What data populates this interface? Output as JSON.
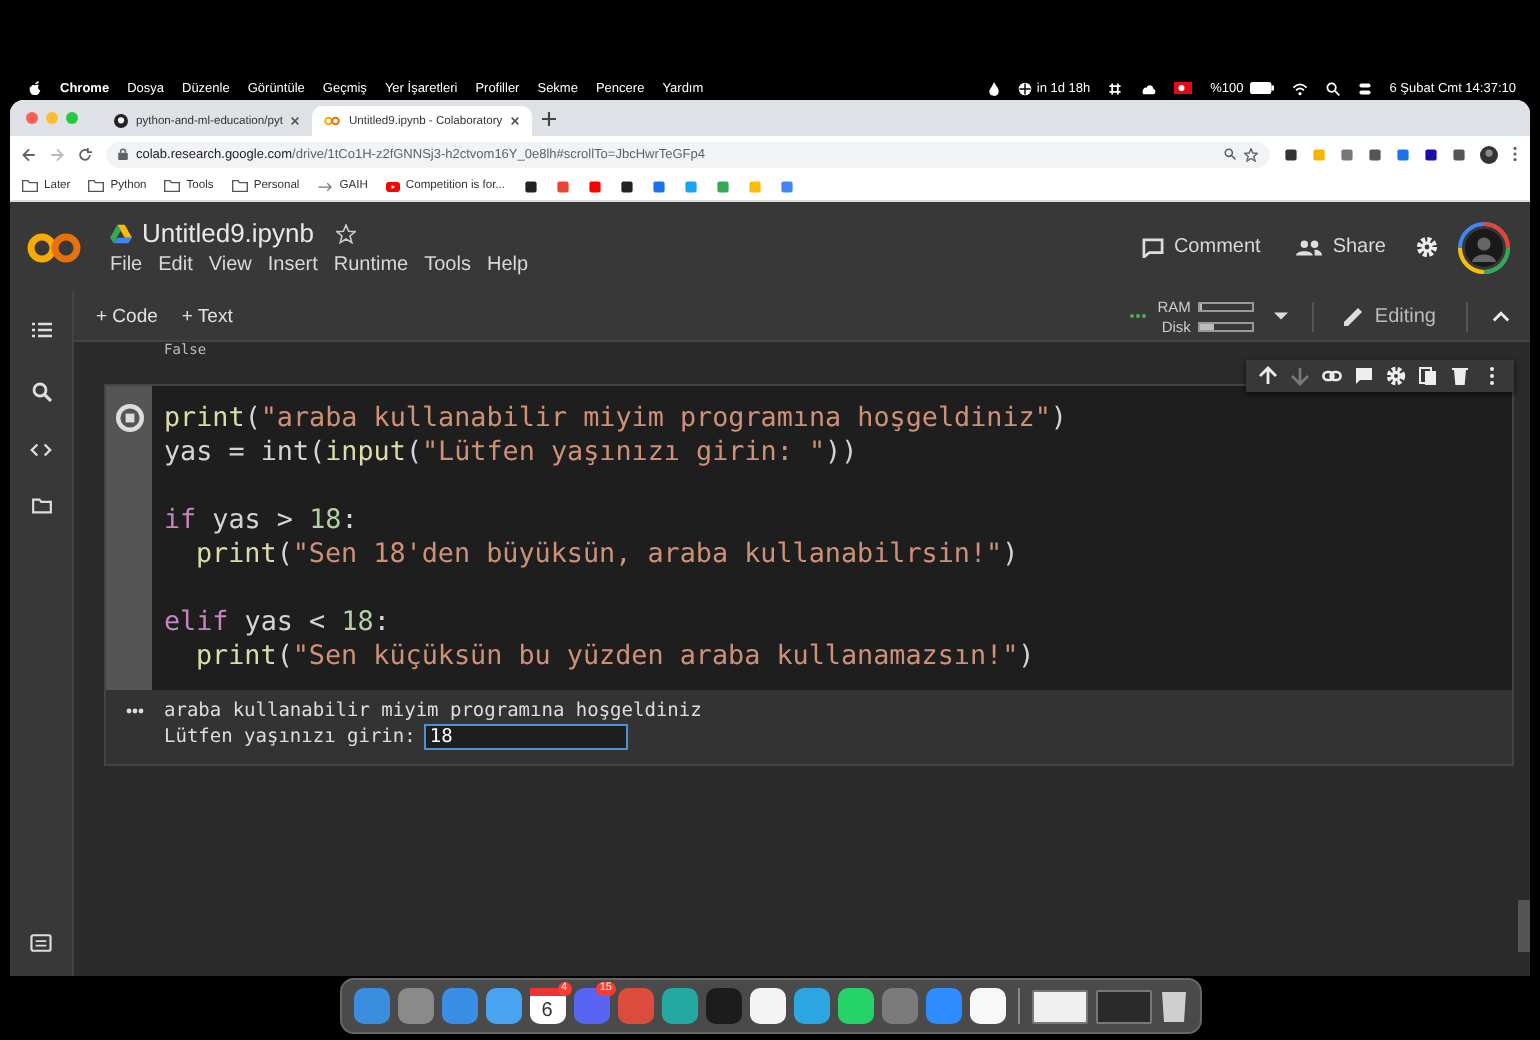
{
  "menubar": {
    "app": "Chrome",
    "menus": [
      "Dosya",
      "Düzenle",
      "Görüntüle",
      "Geçmiş",
      "Yer İşaretleri",
      "Profiller",
      "Sekme",
      "Pencere",
      "Yardım"
    ],
    "timer": "in 1d 18h",
    "battery": "%100",
    "clock": "6 Şubat Cmt  14:37:10"
  },
  "browser": {
    "tabs": [
      {
        "title": "python-and-ml-education/pyt",
        "selected": false
      },
      {
        "title": "Untitled9.ipynb - Colaboratory",
        "selected": true
      }
    ],
    "url_host": "colab.research.google.com",
    "url_path": "/drive/1tCo1H-z2fGNNSj3-h2ctvom16Y_0e8lh#scrollTo=JbcHwrTeGFp4",
    "bookmarks": [
      {
        "kind": "folder",
        "label": "Later"
      },
      {
        "kind": "folder",
        "label": "Python"
      },
      {
        "kind": "folder",
        "label": "Tools"
      },
      {
        "kind": "folder",
        "label": "Personal"
      },
      {
        "kind": "arrow",
        "label": "GAIH"
      },
      {
        "kind": "video",
        "label": "Competition is for..."
      }
    ]
  },
  "colab": {
    "title": "Untitled9.ipynb",
    "menus": [
      "File",
      "Edit",
      "View",
      "Insert",
      "Runtime",
      "Tools",
      "Help"
    ],
    "comment": "Comment",
    "share": "Share",
    "add_buttons": [
      "+ Code",
      "+ Text"
    ],
    "resources": [
      {
        "label": "RAM",
        "level": 0.03
      },
      {
        "label": "Disk",
        "level": 0.25
      }
    ],
    "mode": "Editing"
  },
  "notebook": {
    "previous_output": "False",
    "lines": [
      {
        "kind": "code",
        "indented": false,
        "tokens": [
          {
            "kind": "fn",
            "text": "print"
          },
          {
            "kind": "plain",
            "text": "("
          },
          {
            "kind": "str",
            "text": "\"araba kullanabilir miyim programına hoşgeldiniz\""
          },
          {
            "kind": "plain",
            "text": ")"
          }
        ]
      },
      {
        "kind": "code",
        "indented": false,
        "tokens": [
          {
            "kind": "plain",
            "text": "yas = int("
          },
          {
            "kind": "fn",
            "text": "input"
          },
          {
            "kind": "plain",
            "text": "("
          },
          {
            "kind": "str",
            "text": "\"Lütfen yaşınızı girin: \""
          },
          {
            "kind": "plain",
            "text": "))"
          }
        ]
      },
      {
        "kind": "blank"
      },
      {
        "kind": "code",
        "indented": false,
        "tokens": [
          {
            "kind": "kw",
            "text": "if"
          },
          {
            "kind": "plain",
            "text": " yas > "
          },
          {
            "kind": "num",
            "text": "18"
          },
          {
            "kind": "plain",
            "text": ":"
          }
        ]
      },
      {
        "kind": "code",
        "indented": true,
        "tokens": [
          {
            "kind": "fn",
            "text": "print"
          },
          {
            "kind": "plain",
            "text": "("
          },
          {
            "kind": "str",
            "text": "\"Sen 18'den büyüksün, araba kullanabilrsin!\""
          },
          {
            "kind": "plain",
            "text": ")"
          }
        ]
      },
      {
        "kind": "blank"
      },
      {
        "kind": "code",
        "indented": false,
        "tokens": [
          {
            "kind": "kw",
            "text": "elif"
          },
          {
            "kind": "plain",
            "text": " yas < "
          },
          {
            "kind": "num",
            "text": "18"
          },
          {
            "kind": "plain",
            "text": ":"
          }
        ]
      },
      {
        "kind": "code",
        "indented": true,
        "tokens": [
          {
            "kind": "fn",
            "text": "print"
          },
          {
            "kind": "plain",
            "text": "("
          },
          {
            "kind": "str",
            "text": "\"Sen küçüksün bu yüzden araba kullanamazsın!\""
          },
          {
            "kind": "plain",
            "text": ")"
          }
        ]
      }
    ],
    "output_lines": [
      "araba kullanabilir miyim programına hoşgeldiniz"
    ],
    "prompt": "Lütfen yaşınızı girin:",
    "input_value": "18"
  },
  "dock": [
    {
      "kind": "app",
      "color": "#3b8de0"
    },
    {
      "kind": "app",
      "color": "#8a8a8a"
    },
    {
      "kind": "app",
      "color": "#3a8ee6"
    },
    {
      "kind": "app",
      "color": "#4aa3f0"
    },
    {
      "kind": "calendar",
      "color": "#ffffff",
      "date": "6",
      "badge": "4"
    },
    {
      "kind": "app",
      "color": "#5865f2",
      "badge": "15"
    },
    {
      "kind": "app",
      "color": "#db4c3f"
    },
    {
      "kind": "app",
      "color": "#23a9a0"
    },
    {
      "kind": "app",
      "color": "#1c1c1c"
    },
    {
      "kind": "app",
      "color": "#f4f4f4"
    },
    {
      "kind": "app",
      "color": "#2ca5e0"
    },
    {
      "kind": "app",
      "color": "#25d366"
    },
    {
      "kind": "app",
      "color": "#7a7a7a"
    },
    {
      "kind": "app",
      "color": "#2d8cff"
    },
    {
      "kind": "app",
      "color": "#f8f8f8"
    },
    {
      "kind": "separator"
    },
    {
      "kind": "window",
      "color": "#f0f0f0"
    },
    {
      "kind": "window",
      "color": "#2a2a2a"
    },
    {
      "kind": "trash",
      "color": "#cfcfcf"
    }
  ]
}
